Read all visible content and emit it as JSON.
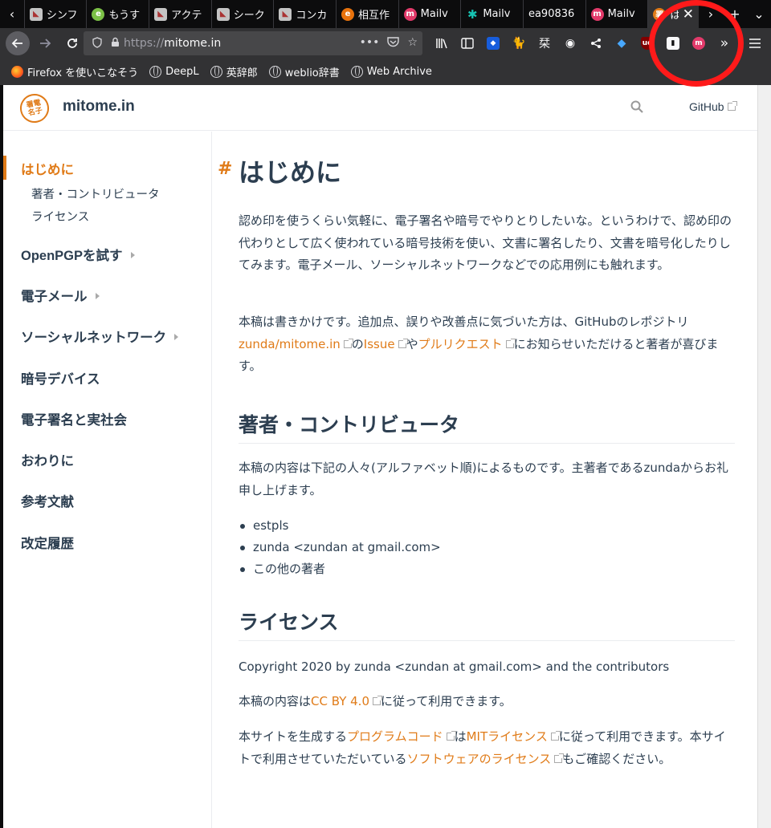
{
  "browser": {
    "tabs": [
      {
        "title": "シンフ",
        "icon": "bird-favicon"
      },
      {
        "title": "もうす",
        "icon": "green-circle-favicon"
      },
      {
        "title": "アクテ",
        "icon": "bird-favicon"
      },
      {
        "title": "シーク",
        "icon": "bird-favicon"
      },
      {
        "title": "コンカ",
        "icon": "bird-favicon"
      },
      {
        "title": "相互作",
        "icon": "orange-e-favicon"
      },
      {
        "title": "Mailv",
        "icon": "mailvelope-favicon"
      },
      {
        "title": "Mailv",
        "icon": "teal-puzzle-favicon"
      },
      {
        "title": "ea90836",
        "icon": ""
      },
      {
        "title": "Mailv",
        "icon": "mailvelope-favicon"
      },
      {
        "title": "は",
        "icon": "mitome-favicon"
      }
    ],
    "url": {
      "scheme": "https://",
      "host": "mitome.in"
    },
    "bookmarks": [
      {
        "label": "Firefox を使いこなそう",
        "icon": "firefox-icon"
      },
      {
        "label": "DeepL",
        "icon": "globe-icon"
      },
      {
        "label": "英辞郎",
        "icon": "globe-icon"
      },
      {
        "label": "weblio辞書",
        "icon": "globe-icon"
      },
      {
        "label": "Web Archive",
        "icon": "globe-icon"
      }
    ]
  },
  "site": {
    "logo_text": "署電\n名子",
    "name": "mitome.in",
    "github_label": "GitHub"
  },
  "sidebar": {
    "current": "はじめに",
    "subitems": [
      "著者・コントリビュータ",
      "ライセンス"
    ],
    "items": [
      {
        "label": "OpenPGPを試す",
        "expandable": true
      },
      {
        "label": "電子メール",
        "expandable": true
      },
      {
        "label": "ソーシャルネットワーク",
        "expandable": true
      },
      {
        "label": "暗号デバイス",
        "expandable": false
      },
      {
        "label": "電子署名と実社会",
        "expandable": false
      },
      {
        "label": "おわりに",
        "expandable": false
      },
      {
        "label": "参考文献",
        "expandable": false
      },
      {
        "label": "改定履歴",
        "expandable": false
      }
    ]
  },
  "content": {
    "h1": "はじめに",
    "anchor": "#",
    "intro": "認め印を使うくらい気軽に、電子署名や暗号でやりとりしたいな。というわけで、認め印の代わりとして広く使われている暗号技術を使い、文書に署名したり、文書を暗号化したりしてみます。電子メール、ソーシャルネットワークなどでの応用例にも触れます。",
    "draft_pre": "本稿は書きかけです。追加点、誤りや改善点に気づいた方は、GitHubのレポジトリ",
    "draft_link1": "zunda/mitome.in",
    "draft_mid1": "の",
    "draft_link2": "Issue",
    "draft_mid2": "や",
    "draft_link3": "プルリクエスト",
    "draft_post": "にお知らせいただけると著者が喜びます。",
    "h2_authors": "著者・コントリビュータ",
    "authors_text": "本稿の内容は下記の人々(アルファベット順)によるものです。主著者であるzundaからお礼申し上げます。",
    "authors": [
      "estpls",
      "zunda <zundan at gmail.com>",
      "この他の著者"
    ],
    "h2_license": "ライセンス",
    "copyright": "Copyright 2020 by zunda <zundan at gmail.com> and the contributors",
    "cc_pre": "本稿の内容は",
    "cc_link": "CC BY 4.0",
    "cc_post": "に従って利用できます。",
    "code_pre": "本サイトを生成する",
    "code_link1": "プログラムコード",
    "code_mid": "は",
    "code_link2": "MITライセンス",
    "code_mid2": "に従って利用できます。本サイトで利用させていただいている",
    "code_link3": "ソフトウェアのライセンス",
    "code_post": "もご確認ください。"
  }
}
